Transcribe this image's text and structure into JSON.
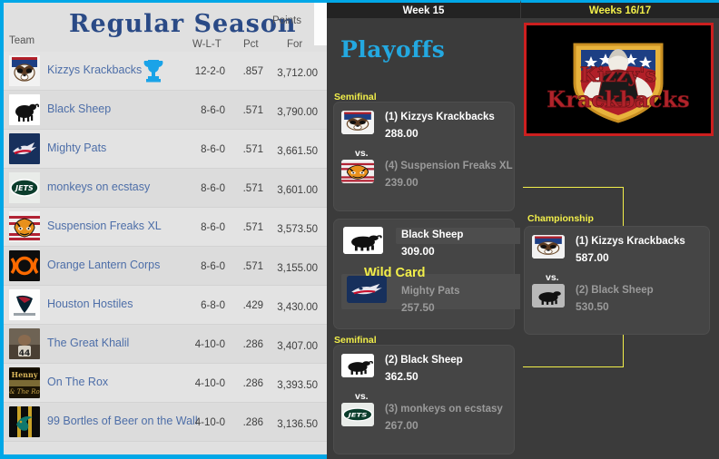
{
  "standings": {
    "title": "Regular Season",
    "points_group_header": "Points",
    "columns": {
      "team": "Team",
      "wlt": "W-L-T",
      "pct": "Pct",
      "points_for": "For"
    },
    "rows": [
      {
        "team": "Kizzys Krackbacks",
        "wlt": "12-2-0",
        "pct": ".857",
        "for": "3,712.00",
        "champion": true,
        "logo": "kizzys"
      },
      {
        "team": "Black Sheep",
        "wlt": "8-6-0",
        "pct": ".571",
        "for": "3,790.00",
        "champion": false,
        "logo": "sheep"
      },
      {
        "team": "Mighty Pats",
        "wlt": "8-6-0",
        "pct": ".571",
        "for": "3,661.50",
        "champion": false,
        "logo": "pats"
      },
      {
        "team": "monkeys on ecstasy",
        "wlt": "8-6-0",
        "pct": ".571",
        "for": "3,601.00",
        "champion": false,
        "logo": "jets"
      },
      {
        "team": "Suspension Freaks XL",
        "wlt": "8-6-0",
        "pct": ".571",
        "for": "3,573.50",
        "champion": false,
        "logo": "tiger"
      },
      {
        "team": "Orange Lantern Corps",
        "wlt": "8-6-0",
        "pct": ".571",
        "for": "3,155.00",
        "champion": false,
        "logo": "lantern"
      },
      {
        "team": "Houston Hostiles",
        "wlt": "6-8-0",
        "pct": ".429",
        "for": "3,430.00",
        "champion": false,
        "logo": "texans"
      },
      {
        "team": "The Great Khalil",
        "wlt": "4-10-0",
        "pct": ".286",
        "for": "3,407.00",
        "champion": false,
        "logo": "khalil"
      },
      {
        "team": "On The Rox",
        "wlt": "4-10-0",
        "pct": ".286",
        "for": "3,393.50",
        "champion": false,
        "logo": "henny"
      },
      {
        "team": "99 Bortles of Beer on the Wall",
        "wlt": "4-10-0",
        "pct": ".286",
        "for": "3,136.50",
        "champion": false,
        "logo": "jags"
      }
    ]
  },
  "bracket": {
    "week_tabs": [
      {
        "label": "Week 15"
      },
      {
        "label": "Weeks 16/17"
      }
    ],
    "heading": "Playoffs",
    "labels": {
      "semifinal_top": "Semifinal",
      "semifinal_bottom": "Semifinal",
      "wild_card": "Wild Card",
      "championship": "Championship",
      "vs": "vs."
    },
    "semifinal_top": {
      "winner": {
        "team": "(1) Kizzys Krackbacks",
        "score": "288.00",
        "logo": "kizzys"
      },
      "loser": {
        "team": "(4) Suspension Freaks XL",
        "score": "239.00",
        "logo": "tiger"
      }
    },
    "wild_card": {
      "winner": {
        "team": "Black Sheep",
        "score": "309.00",
        "logo": "sheep"
      },
      "loser": {
        "team": "Mighty Pats",
        "score": "257.50",
        "logo": "pats"
      }
    },
    "semifinal_bottom": {
      "winner": {
        "team": "(2) Black Sheep",
        "score": "362.50",
        "logo": "sheep"
      },
      "loser": {
        "team": "(3) monkeys on ecstasy",
        "score": "267.00",
        "logo": "jets"
      }
    },
    "championship": {
      "winner": {
        "team": "(1) Kizzys Krackbacks",
        "score": "587.00",
        "logo": "kizzys"
      },
      "loser": {
        "team": "(2) Black Sheep",
        "score": "530.50",
        "logo": "sheep"
      }
    },
    "champion_banner": {
      "name_line1": "Kizzy's",
      "name_line2": "Krackbacks"
    }
  },
  "colors": {
    "accent_blue": "#00a7e7",
    "bracket_yellow": "#f2ef4a",
    "champion_border_red": "#cc1f1f",
    "panel_dark": "#3b3b3b",
    "card_dark": "#454545",
    "team_link_blue": "#4d6ea8"
  }
}
